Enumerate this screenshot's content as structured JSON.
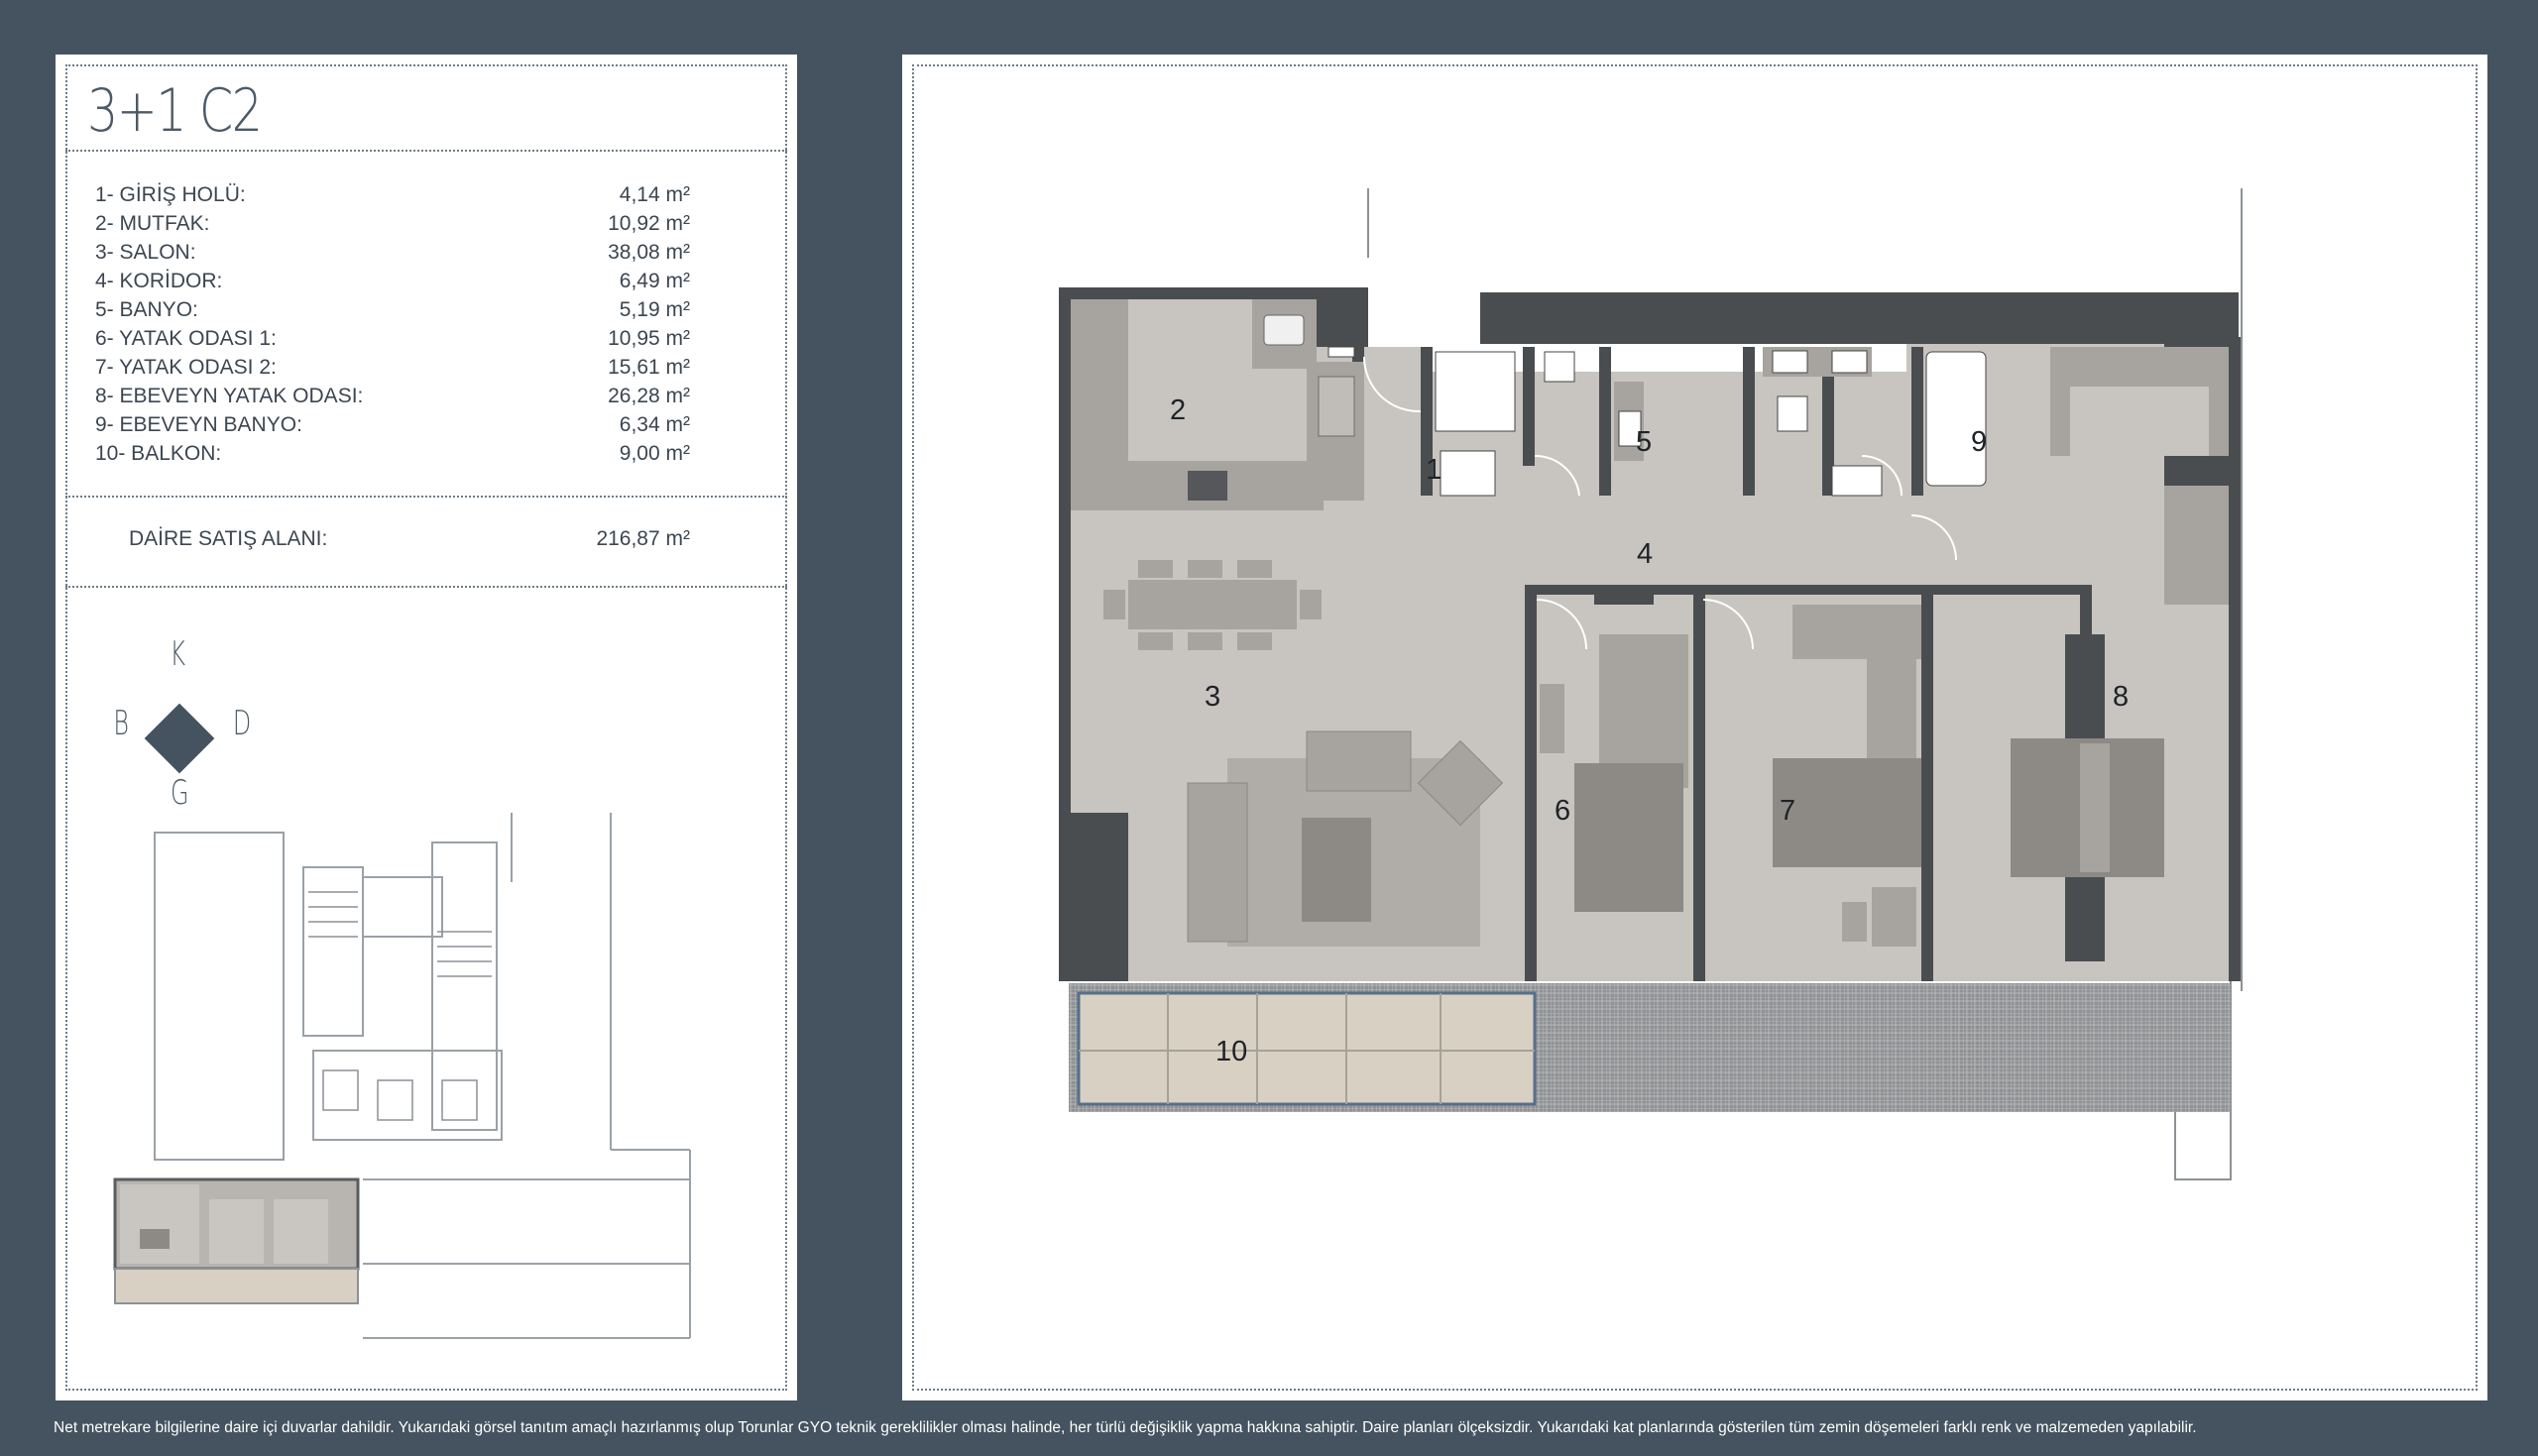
{
  "unit": {
    "title": "3+1 C2"
  },
  "areas": [
    {
      "label": "1- GİRİŞ HOLÜ:",
      "value": "4,14 m²"
    },
    {
      "label": "2- MUTFAK:",
      "value": "10,92 m²"
    },
    {
      "label": "3- SALON:",
      "value": "38,08 m²"
    },
    {
      "label": "4- KORİDOR:",
      "value": "6,49 m²"
    },
    {
      "label": "5- BANYO:",
      "value": "5,19 m²"
    },
    {
      "label": "6- YATAK ODASI 1:",
      "value": "10,95 m²"
    },
    {
      "label": "7- YATAK ODASI 2:",
      "value": "15,61 m²"
    },
    {
      "label": "8- EBEVEYN YATAK ODASI:",
      "value": "26,28 m²"
    },
    {
      "label": "9- EBEVEYN BANYO:",
      "value": "6,34 m²"
    },
    {
      "label": "10- BALKON:",
      "value": "9,00 m²"
    }
  ],
  "total": {
    "label": "DAİRE SATIŞ ALANI:",
    "value": "216,87 m²"
  },
  "compass": {
    "north": "K",
    "west": "B",
    "east": "D",
    "south": "G"
  },
  "rooms": [
    "1",
    "2",
    "3",
    "4",
    "5",
    "6",
    "7",
    "8",
    "9",
    "10"
  ],
  "footer": {
    "note": "Net metrekare bilgilerine daire içi duvarlar dahildir.  Yukarıdaki görsel tanıtım amaçlı hazırlanmış olup Torunlar GYO teknik gereklilikler olması halinde, her türlü değişiklik yapma hakkına sahiptir. Daire planları ölçeksizdir. Yukarıdaki kat planlarında gösterilen tüm zemin döşemeleri farklı renk ve malzemeden yapılabilir."
  },
  "colors": {
    "background": "#44535f",
    "wall": "#4a4d50",
    "floor": "#c8c4bf",
    "furniture": "#a7a39e",
    "balcony": "#d8d0c2"
  }
}
